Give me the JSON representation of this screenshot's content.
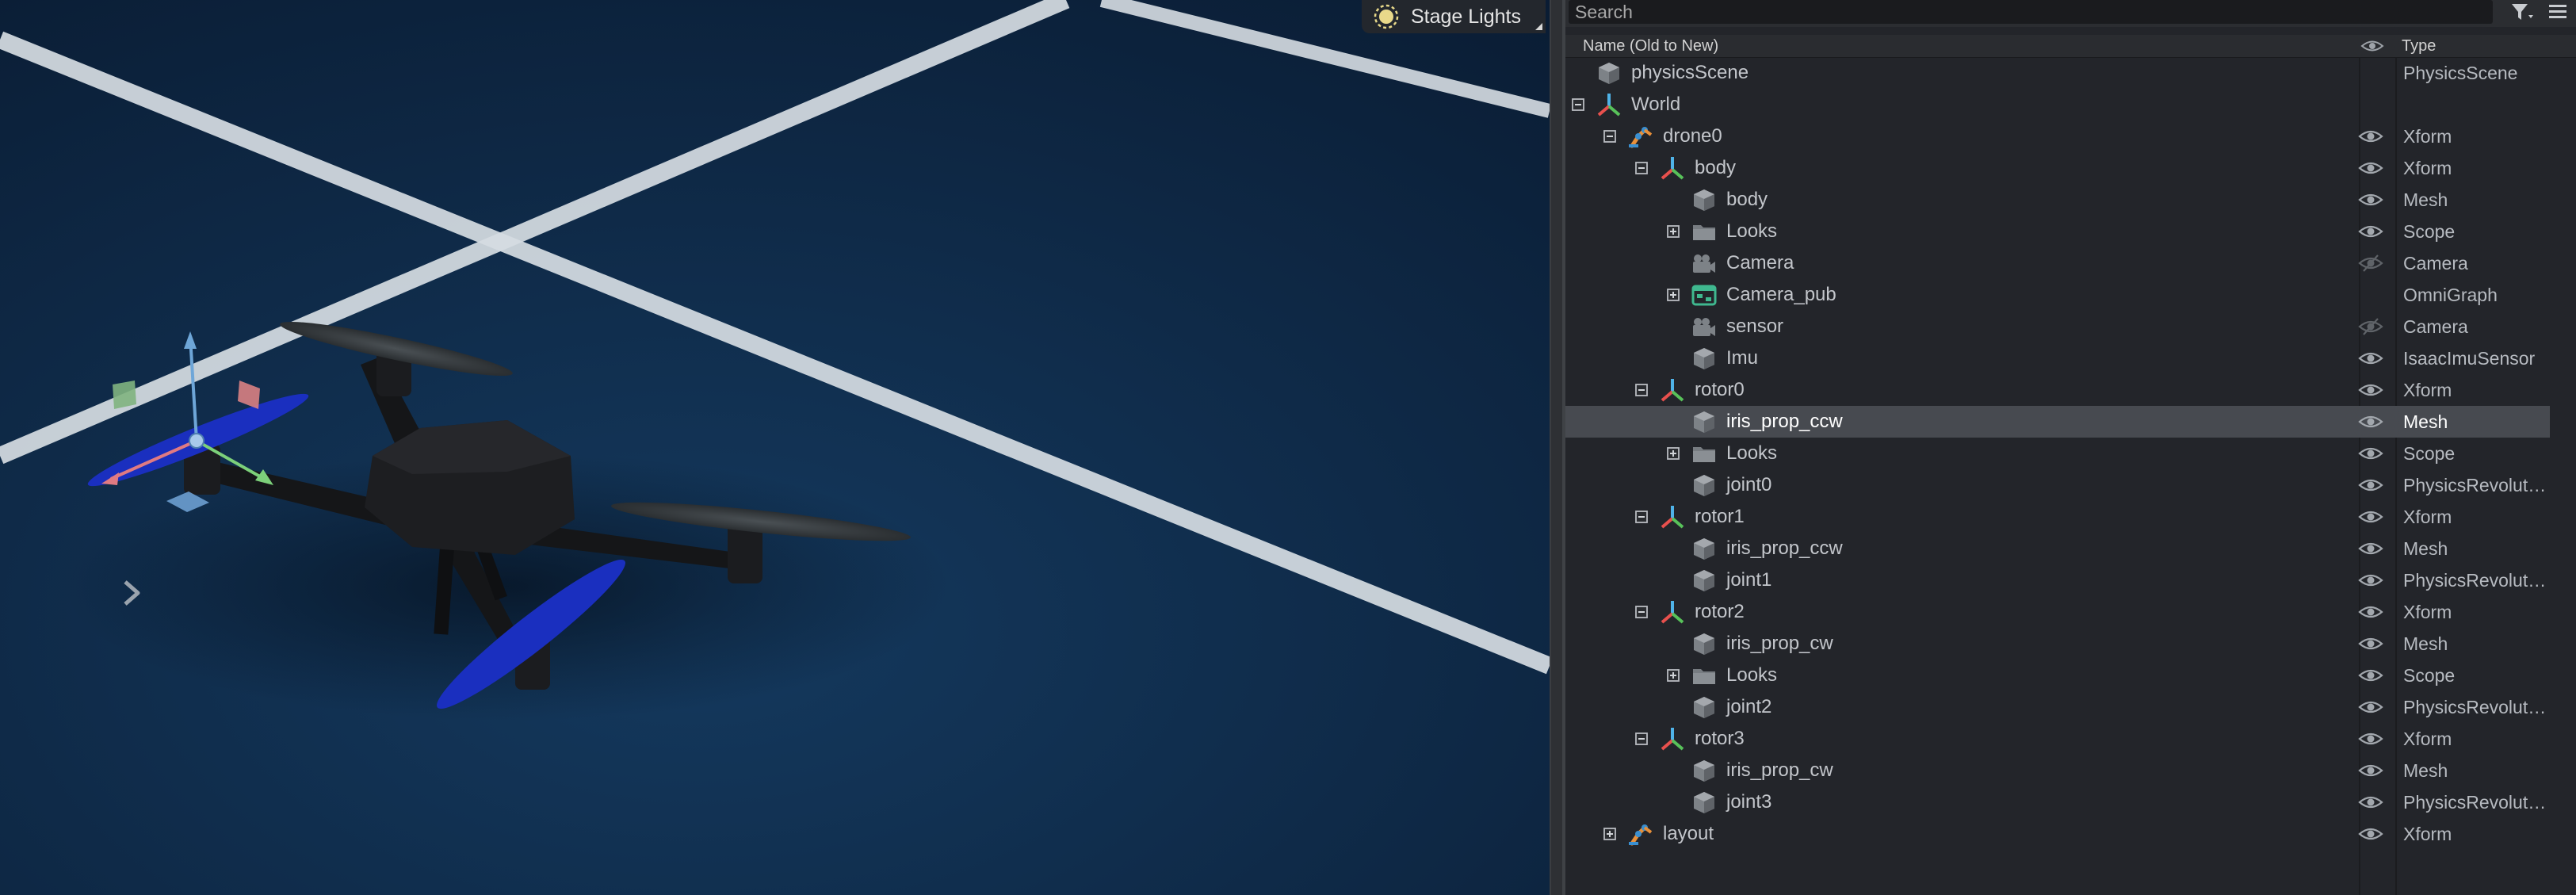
{
  "viewport": {
    "stage_lights_label": "Stage Lights"
  },
  "stage": {
    "search_placeholder": "Search",
    "columns": {
      "name": "Name (Old to New)",
      "type": "Type"
    },
    "rows": [
      {
        "name": "physicsScene",
        "type": "PhysicsScene",
        "depth": 0,
        "expander": "none",
        "icon": "cube-icon",
        "eye": "none"
      },
      {
        "name": "World",
        "type": "",
        "depth": 0,
        "expander": "collapse",
        "icon": "xform-axes-icon",
        "eye": "none"
      },
      {
        "name": "drone0",
        "type": "Xform",
        "depth": 1,
        "expander": "collapse",
        "icon": "robot-arm-icon",
        "eye": "visible"
      },
      {
        "name": "body",
        "type": "Xform",
        "depth": 2,
        "expander": "collapse",
        "icon": "xform-axes-icon",
        "eye": "visible"
      },
      {
        "name": "body",
        "type": "Mesh",
        "depth": 3,
        "expander": "none",
        "icon": "cube-icon",
        "eye": "visible"
      },
      {
        "name": "Looks",
        "type": "Scope",
        "depth": 3,
        "expander": "expand",
        "icon": "folder-icon",
        "eye": "visible"
      },
      {
        "name": "Camera",
        "type": "Camera",
        "depth": 3,
        "expander": "none",
        "icon": "camera-icon",
        "eye": "hidden"
      },
      {
        "name": "Camera_pub",
        "type": "OmniGraph",
        "depth": 3,
        "expander": "expand",
        "icon": "omnigraph-icon",
        "eye": "none"
      },
      {
        "name": "sensor",
        "type": "Camera",
        "depth": 3,
        "expander": "none",
        "icon": "camera-icon",
        "eye": "hidden"
      },
      {
        "name": "Imu",
        "type": "IsaacImuSensor",
        "depth": 3,
        "expander": "none",
        "icon": "cube-icon",
        "eye": "visible"
      },
      {
        "name": "rotor0",
        "type": "Xform",
        "depth": 2,
        "expander": "collapse",
        "icon": "xform-axes-icon",
        "eye": "visible"
      },
      {
        "name": "iris_prop_ccw",
        "type": "Mesh",
        "depth": 3,
        "expander": "none",
        "icon": "cube-icon",
        "eye": "visible",
        "selected": true
      },
      {
        "name": "Looks",
        "type": "Scope",
        "depth": 3,
        "expander": "expand",
        "icon": "folder-icon",
        "eye": "visible"
      },
      {
        "name": "joint0",
        "type": "PhysicsRevolute…",
        "depth": 3,
        "expander": "none",
        "icon": "cube-icon",
        "eye": "visible"
      },
      {
        "name": "rotor1",
        "type": "Xform",
        "depth": 2,
        "expander": "collapse",
        "icon": "xform-axes-icon",
        "eye": "visible"
      },
      {
        "name": "iris_prop_ccw",
        "type": "Mesh",
        "depth": 3,
        "expander": "none",
        "icon": "cube-icon",
        "eye": "visible"
      },
      {
        "name": "joint1",
        "type": "PhysicsRevolute…",
        "depth": 3,
        "expander": "none",
        "icon": "cube-icon",
        "eye": "visible"
      },
      {
        "name": "rotor2",
        "type": "Xform",
        "depth": 2,
        "expander": "collapse",
        "icon": "xform-axes-icon",
        "eye": "visible"
      },
      {
        "name": "iris_prop_cw",
        "type": "Mesh",
        "depth": 3,
        "expander": "none",
        "icon": "cube-icon",
        "eye": "visible"
      },
      {
        "name": "Looks",
        "type": "Scope",
        "depth": 3,
        "expander": "expand",
        "icon": "folder-icon",
        "eye": "visible"
      },
      {
        "name": "joint2",
        "type": "PhysicsRevolute…",
        "depth": 3,
        "expander": "none",
        "icon": "cube-icon",
        "eye": "visible"
      },
      {
        "name": "rotor3",
        "type": "Xform",
        "depth": 2,
        "expander": "collapse",
        "icon": "xform-axes-icon",
        "eye": "visible"
      },
      {
        "name": "iris_prop_cw",
        "type": "Mesh",
        "depth": 3,
        "expander": "none",
        "icon": "cube-icon",
        "eye": "visible"
      },
      {
        "name": "joint3",
        "type": "PhysicsRevolute…",
        "depth": 3,
        "expander": "none",
        "icon": "cube-icon",
        "eye": "visible"
      },
      {
        "name": "layout",
        "type": "Xform",
        "depth": 1,
        "expander": "expand",
        "icon": "robot-arm-icon",
        "eye": "visible"
      }
    ]
  }
}
